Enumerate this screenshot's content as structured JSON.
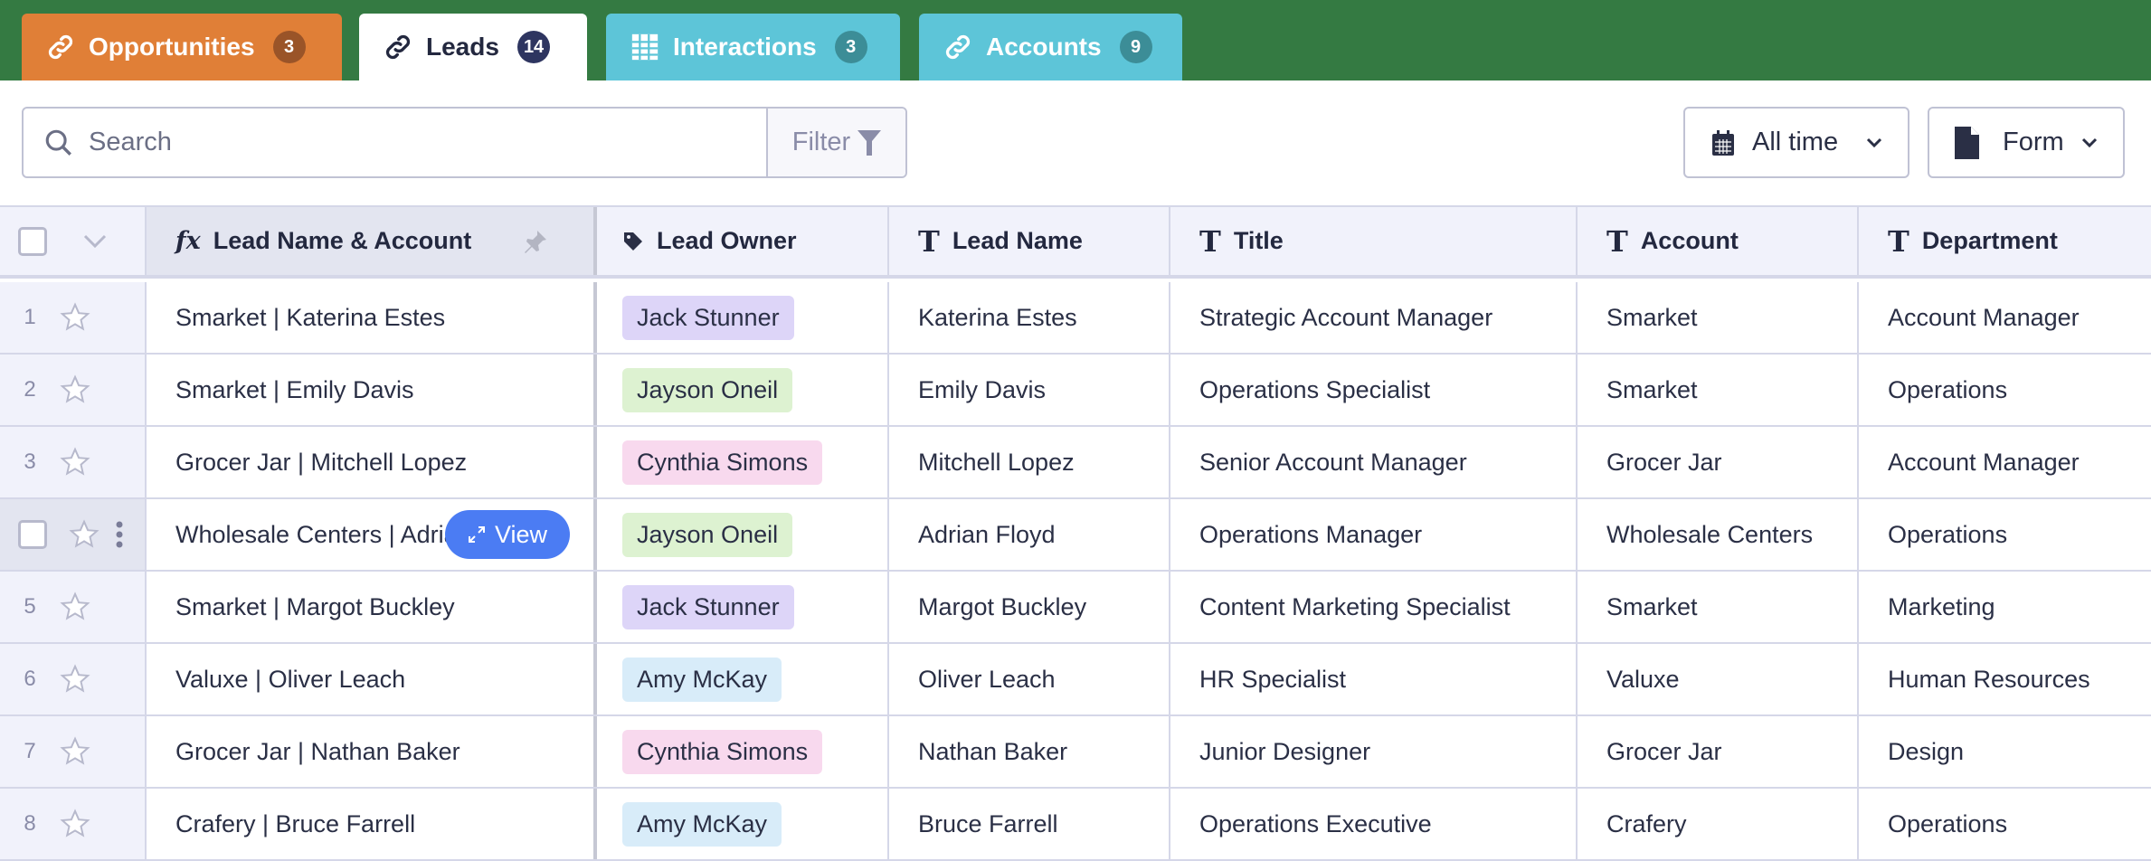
{
  "tabs": [
    {
      "label": "Opportunities",
      "count": "3",
      "icon": "link-icon",
      "bg": "#e07f37",
      "badge": "#9a5428"
    },
    {
      "label": "Leads",
      "count": "14",
      "icon": "link-icon",
      "bg": "#ffffff",
      "badge": "#2e3560"
    },
    {
      "label": "Interactions",
      "count": "3",
      "icon": "table-icon",
      "bg": "#5dc5d8",
      "badge": "#3c8d97"
    },
    {
      "label": "Accounts",
      "count": "9",
      "icon": "link-icon",
      "bg": "#5dc5d8",
      "badge": "#3c8d97"
    }
  ],
  "toolbar": {
    "search_placeholder": "Search",
    "filter_label": "Filter",
    "date_label": "All time",
    "form_label": "Form"
  },
  "columns": [
    "Lead Name & Account",
    "Lead Owner",
    "Lead Name",
    "Title",
    "Account",
    "Department"
  ],
  "view_label": "View",
  "owner_colors": {
    "Jack Stunner": "#ddd5f8",
    "Jayson Oneil": "#ddf2d1",
    "Cynthia Simons": "#f8d9ee",
    "Amy McKay": "#d8ecf9"
  },
  "rows": [
    {
      "n": "1",
      "name_account": "Smarket | Katerina Estes",
      "owner": "Jack Stunner",
      "lead": "Katerina Estes",
      "title": "Strategic Account Manager",
      "account": "Smarket",
      "dept": "Account Manager"
    },
    {
      "n": "2",
      "name_account": "Smarket | Emily Davis",
      "owner": "Jayson Oneil",
      "lead": "Emily Davis",
      "title": "Operations Specialist",
      "account": "Smarket",
      "dept": "Operations"
    },
    {
      "n": "3",
      "name_account": "Grocer Jar | Mitchell Lopez",
      "owner": "Cynthia Simons",
      "lead": "Mitchell Lopez",
      "title": "Senior Account Manager",
      "account": "Grocer Jar",
      "dept": "Account Manager"
    },
    {
      "n": "4",
      "name_account": "Wholesale Centers | Adrian Floyd",
      "owner": "Jayson Oneil",
      "lead": "Adrian Floyd",
      "title": "Operations Manager",
      "account": "Wholesale Centers",
      "dept": "Operations"
    },
    {
      "n": "5",
      "name_account": "Smarket | Margot Buckley",
      "owner": "Jack Stunner",
      "lead": "Margot Buckley",
      "title": "Content Marketing Specialist",
      "account": "Smarket",
      "dept": "Marketing"
    },
    {
      "n": "6",
      "name_account": "Valuxe | Oliver Leach",
      "owner": "Amy McKay",
      "lead": "Oliver Leach",
      "title": "HR Specialist",
      "account": "Valuxe",
      "dept": "Human Resources"
    },
    {
      "n": "7",
      "name_account": "Grocer Jar | Nathan Baker",
      "owner": "Cynthia Simons",
      "lead": "Nathan Baker",
      "title": "Junior Designer",
      "account": "Grocer Jar",
      "dept": "Design"
    },
    {
      "n": "8",
      "name_account": "Crafery | Bruce Farrell",
      "owner": "Amy McKay",
      "lead": "Bruce Farrell",
      "title": "Operations Executive",
      "account": "Crafery",
      "dept": "Operations"
    }
  ]
}
